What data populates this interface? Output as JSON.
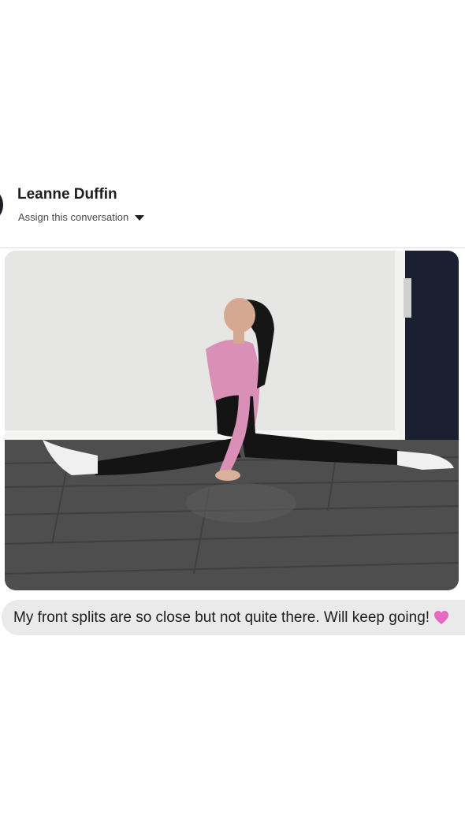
{
  "conversation": {
    "contact_name": "Leanne Duffin",
    "assign_label": "Assign this conversation"
  },
  "message": {
    "text": "My front splits are so close but not quite there. Will keep going!",
    "emoji": "pink-heart-icon"
  },
  "colors": {
    "name_text": "#1c1e21",
    "bubble_bg": "#eaeaea",
    "heart": "#e46bbd"
  }
}
